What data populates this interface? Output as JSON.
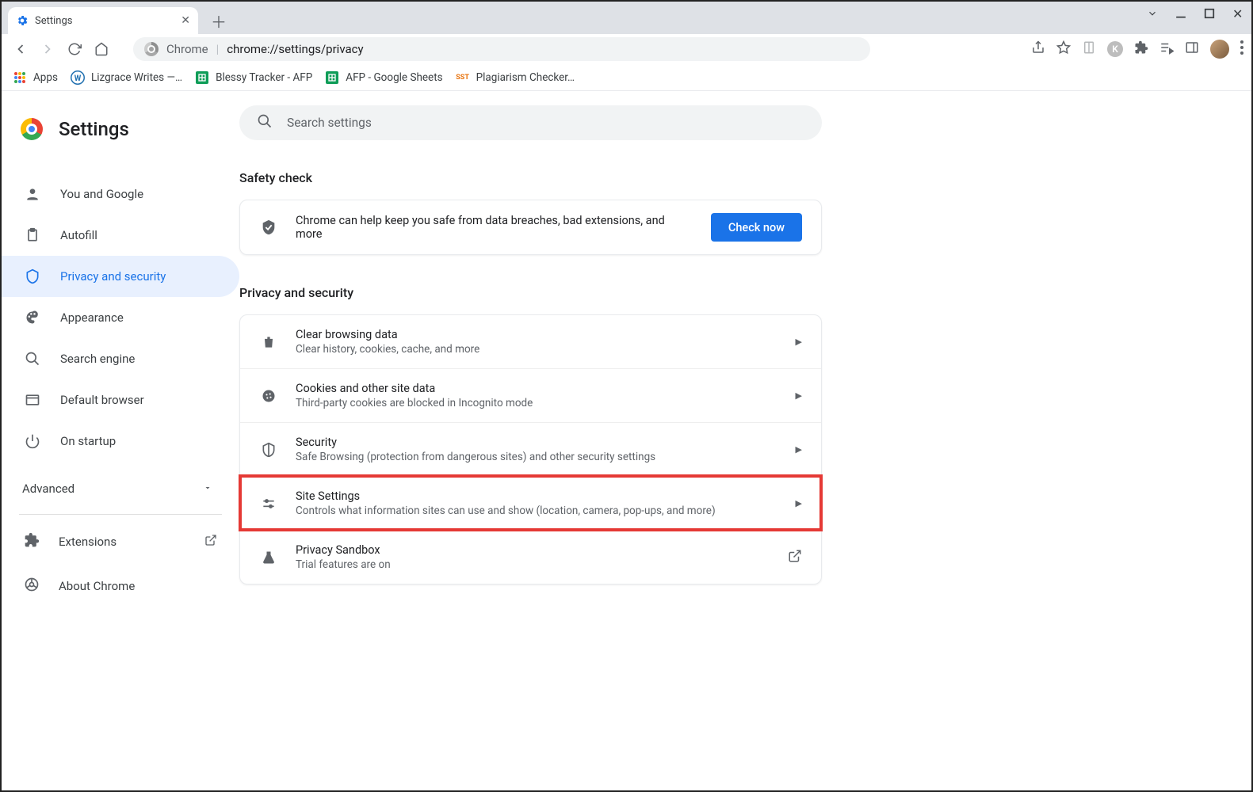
{
  "window": {
    "tab_title": "Settings"
  },
  "toolbar": {
    "omnibox_label": "Chrome",
    "omnibox_url": "chrome://settings/privacy"
  },
  "bookmarks": {
    "apps": "Apps",
    "items": [
      {
        "label": "Lizgrace Writes —…"
      },
      {
        "label": "Blessy Tracker - AFP"
      },
      {
        "label": "AFP - Google Sheets"
      },
      {
        "label": "Plagiarism Checker…"
      }
    ]
  },
  "sidebar": {
    "heading": "Settings",
    "items": [
      {
        "label": "You and Google"
      },
      {
        "label": "Autofill"
      },
      {
        "label": "Privacy and security"
      },
      {
        "label": "Appearance"
      },
      {
        "label": "Search engine"
      },
      {
        "label": "Default browser"
      },
      {
        "label": "On startup"
      }
    ],
    "advanced": "Advanced",
    "extensions": "Extensions",
    "about": "About Chrome"
  },
  "main": {
    "search_placeholder": "Search settings",
    "safety_heading": "Safety check",
    "safety_text": "Chrome can help keep you safe from data breaches, bad extensions, and more",
    "check_now": "Check now",
    "privacy_heading": "Privacy and security",
    "rows": [
      {
        "title": "Clear browsing data",
        "desc": "Clear history, cookies, cache, and more"
      },
      {
        "title": "Cookies and other site data",
        "desc": "Third-party cookies are blocked in Incognito mode"
      },
      {
        "title": "Security",
        "desc": "Safe Browsing (protection from dangerous sites) and other security settings"
      },
      {
        "title": "Site Settings",
        "desc": "Controls what information sites can use and show (location, camera, pop-ups, and more)"
      },
      {
        "title": "Privacy Sandbox",
        "desc": "Trial features are on"
      }
    ]
  }
}
